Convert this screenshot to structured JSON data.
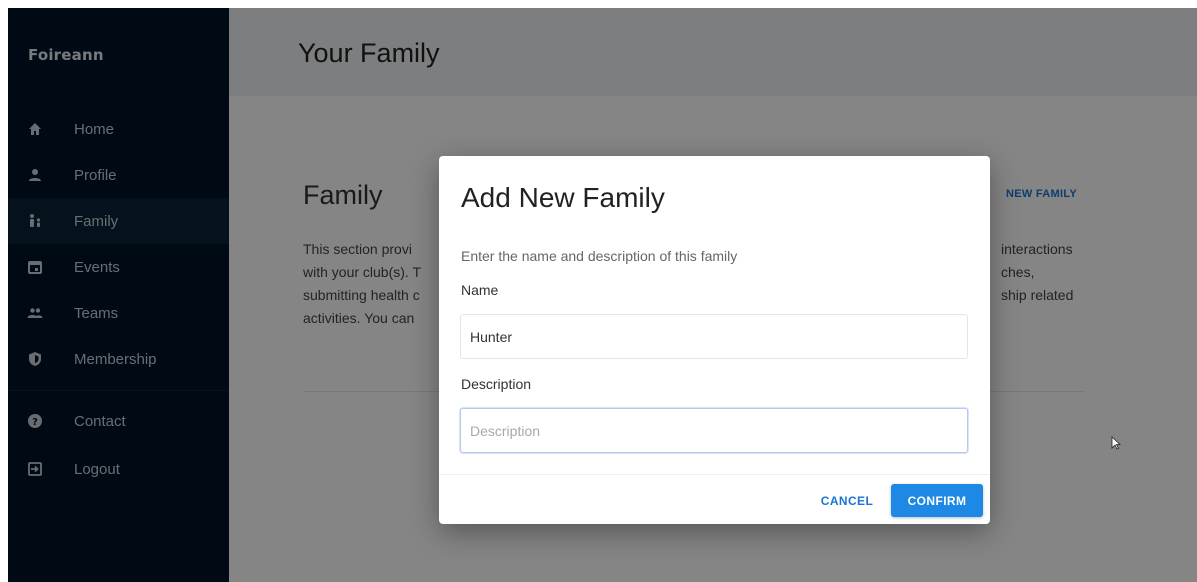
{
  "sidebar": {
    "brand": "Foireann",
    "items": [
      {
        "label": "Home",
        "icon": "home-icon"
      },
      {
        "label": "Profile",
        "icon": "person-icon"
      },
      {
        "label": "Family",
        "icon": "family-icon",
        "active": true
      },
      {
        "label": "Events",
        "icon": "calendar-icon"
      },
      {
        "label": "Teams",
        "icon": "group-icon"
      },
      {
        "label": "Membership",
        "icon": "shield-icon"
      },
      {
        "label": "Contact",
        "icon": "help-icon"
      },
      {
        "label": "Logout",
        "icon": "logout-icon"
      }
    ]
  },
  "header": {
    "title": "Your Family"
  },
  "family_card": {
    "title": "Family",
    "action_label": "NEW FAMILY",
    "text_lines": [
      "This section provi",
      "with your club(s). T",
      "submitting health c",
      "activities. You can"
    ],
    "text_right_lines": [
      "interactions",
      "ches,",
      "ship related"
    ]
  },
  "modal": {
    "title": "Add New Family",
    "description": "Enter the name and description of this family",
    "name_label": "Name",
    "name_value": "Hunter",
    "description_label": "Description",
    "description_placeholder": "Description",
    "cancel_label": "CANCEL",
    "confirm_label": "CONFIRM"
  },
  "colors": {
    "sidebar_bg": "#001529",
    "accent": "#1e88e5",
    "link": "#1976d2"
  }
}
